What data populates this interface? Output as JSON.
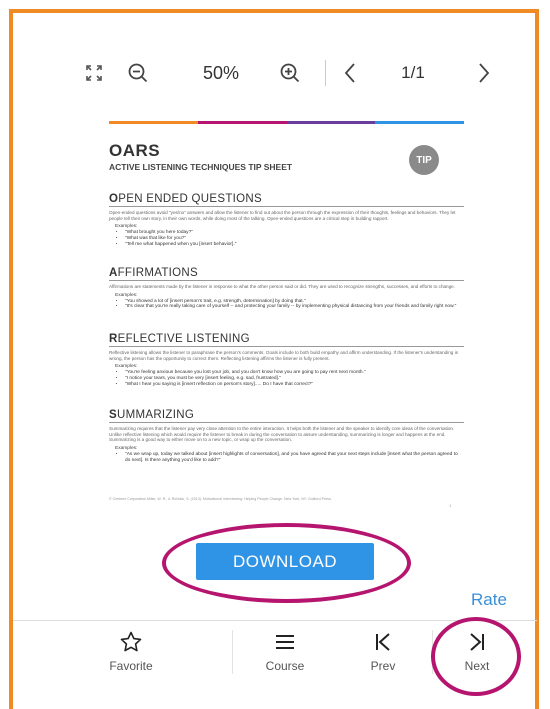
{
  "toolbar": {
    "zoom_level": "50%",
    "page_indicator": "1/1"
  },
  "document": {
    "title": "OARS",
    "subtitle": "ACTIVE LISTENING TECHNIQUES TIP SHEET",
    "badge": "TIP",
    "bar_colors": [
      "#f08a24",
      "#b5156e",
      "#6a3d9a",
      "#2f93e6"
    ],
    "sections": [
      {
        "head_initial": "O",
        "head_rest": "PEN ENDED QUESTIONS",
        "body": "Open-ended questions avoid \"yes/no\" answers and allow the listener to find out about the person through the expression of their thoughts, feelings and behaviors. They let people tell their own story, in their own words, while doing most of the talking. Open-ended questions are a critical step in building rapport.",
        "examples_label": "Examples:",
        "examples": [
          "\"What brought you here today?\"",
          "\"What was that like for you?\"",
          "\"Tell me what happened when you [insert behavior].\""
        ]
      },
      {
        "head_initial": "A",
        "head_rest": "FFIRMATIONS",
        "body": "Affirmations are statements made by the listener in response to what the other person said or did. They are used to recognize strengths, successes, and efforts to change.",
        "examples_label": "Examples:",
        "examples": [
          "\"You showed a lot of [insert person's trait, e.g. strength, determination] by doing that.\"",
          "\"It's clear that you're really taking care of yourself -- and protecting your family -- by implementing physical distancing from your friends and family right now.\""
        ]
      },
      {
        "head_initial": "R",
        "head_rest": "EFLECTIVE LISTENING",
        "body": "Reflective listening allows the listener to paraphrase the person's comments. Goals include to both build empathy and affirm understanding. If the listener's understanding is wrong, the person has the opportunity to correct them. Reflecting listening affirms the listener is fully present.",
        "examples_label": "Examples:",
        "examples": [
          "\"You're feeling anxious because you lost your job, and you don't know how you are going to pay rent next month.\"",
          "\"I notice your tears, you must be very [insert feeling, e.g. sad, frustrated].\"",
          "\"What I hear you saying is [insert reflection on person's story]..... Do I have that correct?\""
        ]
      },
      {
        "head_initial": "S",
        "head_rest": "UMMARIZING",
        "body": "Summarizing requires that the listener pay very close attention to the entire interaction. It helps both the listener and the speaker to identify core ideas of the conversation. Unlike reflective listening which would require the listener to break in during the conversation to assure understanding, summarizing is longer and happens at the end. Summarizing is a good way to either move on to a new topic, or wrap up the conversation.",
        "examples_label": "Examples:",
        "examples": [
          "\"As we wrap up, today we talked about [insert highlights of conversation], and you have agreed that your next steps include [insert what the person agreed to do next]. Is there anything you'd like to add?\""
        ]
      }
    ],
    "footer": "© Centene Corporation     Miller, W. R., & Rollnick, S. (2013). Motivational interviewing: Helping People Change. New York, NY: Guilford Press.",
    "page_number": "1"
  },
  "download_label": "DOWNLOAD",
  "rate_label": "Rate",
  "nav": {
    "favorite": "Favorite",
    "course": "Course",
    "prev": "Prev",
    "next": "Next"
  },
  "colors": {
    "frame": "#f08a24",
    "highlight_ring": "#b5156e",
    "download_button": "#2f93e6",
    "rate_link": "#3a8fd8"
  }
}
